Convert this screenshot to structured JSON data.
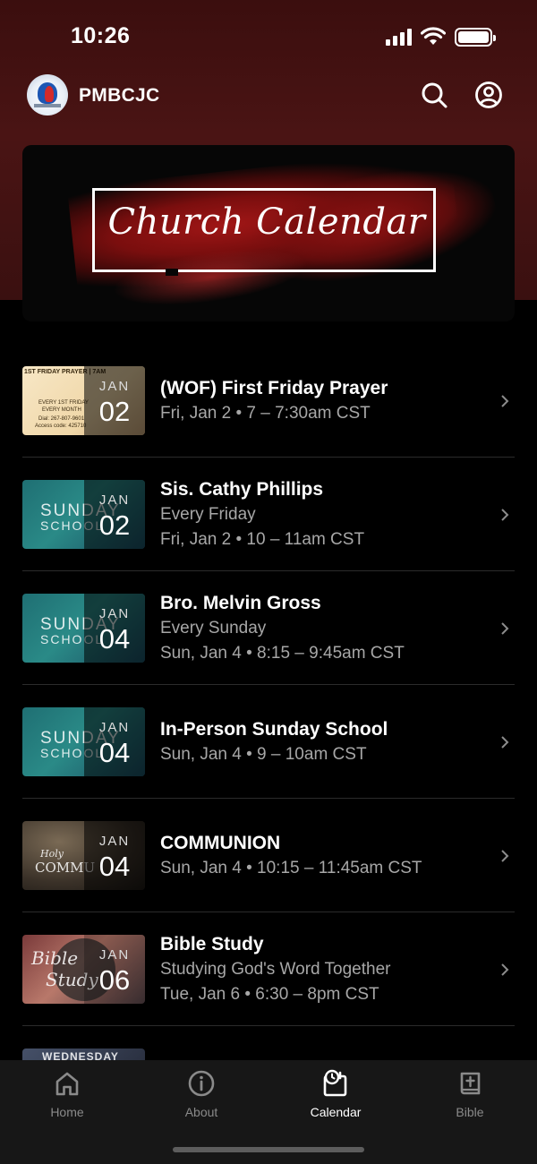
{
  "status_bar": {
    "time": "10:26"
  },
  "header": {
    "brand": "PMBCJC"
  },
  "banner": {
    "title": "Church Calendar"
  },
  "events": [
    {
      "title": "(WOF) First Friday Prayer",
      "lines": [
        "Fri, Jan 2 • 7 – 7:30am CST"
      ],
      "month": "JAN",
      "day": "02",
      "thumb": "wof"
    },
    {
      "title": "Sis. Cathy Phillips",
      "lines": [
        "Every Friday",
        "Fri, Jan 2 • 10 – 11am CST"
      ],
      "month": "JAN",
      "day": "02",
      "thumb": "sunday-school"
    },
    {
      "title": "Bro. Melvin Gross",
      "lines": [
        "Every Sunday",
        "Sun, Jan 4 • 8:15 – 9:45am CST"
      ],
      "month": "JAN",
      "day": "04",
      "thumb": "sunday-school"
    },
    {
      "title": "In-Person Sunday School",
      "lines": [
        "Sun, Jan 4 • 9 – 10am CST"
      ],
      "month": "JAN",
      "day": "04",
      "thumb": "sunday-school"
    },
    {
      "title": "COMMUNION",
      "lines": [
        "Sun, Jan 4 • 10:15 – 11:45am CST"
      ],
      "month": "JAN",
      "day": "04",
      "thumb": "communion"
    },
    {
      "title": "Bible Study",
      "lines": [
        "Studying God's Word Together",
        "Tue, Jan 6 • 6:30 – 8pm CST"
      ],
      "month": "JAN",
      "day": "06",
      "thumb": "bible-study"
    }
  ],
  "thumb_text": {
    "wof_header": "1ST FRIDAY PRAYER | 7AM",
    "wof_line1": "EVERY 1ST FRIDAY",
    "wof_line2": "EVERY MONTH",
    "wof_line3": "Dial: 267-807-9601",
    "wof_line4": "Access code: 425710",
    "ss_line1": "SUNDAY",
    "ss_line2": "SCHOOL",
    "comm_line1": "Holy",
    "comm_line2": "COMMU",
    "bible_line1": "Bible",
    "bible_line2": "Study",
    "wed": "WEDNESDAY"
  },
  "nav": {
    "home": "Home",
    "about": "About",
    "calendar": "Calendar",
    "bible": "Bible",
    "active": "Calendar"
  }
}
